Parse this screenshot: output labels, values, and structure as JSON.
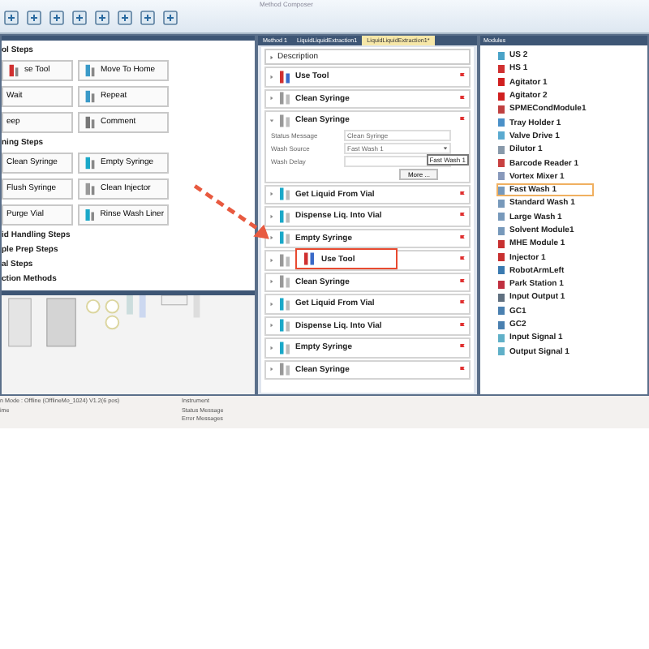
{
  "window": {
    "title": "Method Composer"
  },
  "palette": {
    "groups": [
      {
        "title": "ol Steps",
        "buttons": [
          {
            "label": "se Tool",
            "kind": "tool"
          },
          {
            "label": "Move To Home",
            "kind": "home"
          },
          {
            "label": "Wait",
            "kind": "plain"
          },
          {
            "label": "Repeat",
            "kind": "repeat"
          },
          {
            "label": "eep",
            "kind": "plain"
          },
          {
            "label": "Comment",
            "kind": "comment"
          }
        ]
      },
      {
        "title": "ning Steps",
        "buttons": [
          {
            "label": "Clean Syringe",
            "kind": "plain"
          },
          {
            "label": "Empty Syringe",
            "kind": "transfer"
          },
          {
            "label": "Flush Syringe",
            "kind": "plain"
          },
          {
            "label": "Clean Injector",
            "kind": "clean"
          },
          {
            "label": "Purge Vial",
            "kind": "plain"
          },
          {
            "label": "Rinse Wash Liner",
            "kind": "transfer"
          }
        ]
      },
      {
        "title": "id Handling Steps"
      },
      {
        "title": "ple Prep Steps"
      },
      {
        "title": "al Steps"
      },
      {
        "title": "ction Methods"
      }
    ]
  },
  "editor": {
    "tabs": [
      {
        "label": "Method 1",
        "selected": false
      },
      {
        "label": "LiquidLiquidExtraction1",
        "selected": false
      },
      {
        "label": "LiquidLiquidExtraction1*",
        "selected": true
      }
    ],
    "description": "Description",
    "steps": [
      {
        "name": "Use Tool",
        "kind": "tool",
        "expanded": false,
        "drag_target": false
      },
      {
        "name": "Clean Syringe",
        "kind": "clean",
        "expanded": false,
        "drag_target": false
      },
      {
        "name": "Clean Syringe",
        "kind": "clean",
        "expanded": true,
        "drag_target": false,
        "fields": [
          {
            "label": "Status Message",
            "value": "Clean Syringe",
            "kind": "text"
          },
          {
            "label": "Wash Source",
            "value": "Fast Wash 1",
            "kind": "select"
          },
          {
            "label": "Wash Delay",
            "kind": "number"
          }
        ],
        "tooltip": "Fast Wash 1",
        "more": "More ..."
      },
      {
        "name": "Get Liquid From Vial",
        "kind": "transfer",
        "expanded": false,
        "drag_target": false
      },
      {
        "name": "Dispense Liq. Into Vial",
        "kind": "transfer",
        "expanded": false,
        "drag_target": false
      },
      {
        "name": "Empty Syringe",
        "kind": "transfer",
        "expanded": false,
        "drag_target": false
      },
      {
        "kind": "clean",
        "expanded": false,
        "drag_target": true
      },
      {
        "name": "Clean Syringe",
        "kind": "clean",
        "expanded": false,
        "drag_target": false
      },
      {
        "name": "Get Liquid From Vial",
        "kind": "transfer",
        "expanded": false,
        "drag_target": false
      },
      {
        "name": "Dispense Liq. Into Vial",
        "kind": "transfer",
        "expanded": false,
        "drag_target": false
      },
      {
        "name": "Empty Syringe",
        "kind": "transfer",
        "expanded": false,
        "drag_target": false
      },
      {
        "name": "Clean Syringe",
        "kind": "clean",
        "expanded": false,
        "drag_target": false
      }
    ],
    "drag_preview": {
      "label": "Use Tool"
    }
  },
  "modules": {
    "title": "Modules",
    "items": [
      {
        "name": "US 2",
        "color": "#4aa3c8",
        "selected": false
      },
      {
        "name": "HS 1",
        "color": "#d03030",
        "selected": false
      },
      {
        "name": "Agitator 1",
        "color": "#d02020",
        "selected": false
      },
      {
        "name": "Agitator 2",
        "color": "#d02020",
        "selected": false
      },
      {
        "name": "SPMECondModule1",
        "color": "#c04040",
        "selected": false
      },
      {
        "name": "Tray Holder 1",
        "color": "#4a90c8",
        "selected": false
      },
      {
        "name": "Valve Drive 1",
        "color": "#5aaad0",
        "selected": false
      },
      {
        "name": "Dilutor 1",
        "color": "#8899aa",
        "selected": false
      },
      {
        "name": "Barcode Reader 1",
        "color": "#c84040",
        "selected": false
      },
      {
        "name": "Vortex Mixer 1",
        "color": "#8899bb",
        "selected": false
      },
      {
        "name": "Fast Wash 1",
        "color": "#7799bb",
        "selected": true
      },
      {
        "name": "Standard Wash 1",
        "color": "#7799bb",
        "selected": false
      },
      {
        "name": "Large Wash 1",
        "color": "#7799bb",
        "selected": false
      },
      {
        "name": "Solvent Module1",
        "color": "#7799bb",
        "selected": false
      },
      {
        "name": "MHE Module 1",
        "color": "#c83030",
        "selected": false
      },
      {
        "name": "Injector 1",
        "color": "#c83030",
        "selected": false
      },
      {
        "name": "RobotArmLeft",
        "color": "#3a7ab0",
        "selected": false
      },
      {
        "name": "Park Station 1",
        "color": "#c03040",
        "selected": false
      },
      {
        "name": "Input Output 1",
        "color": "#607080",
        "selected": false
      },
      {
        "name": "GC1",
        "color": "#4a80b0",
        "selected": false
      },
      {
        "name": "GC2",
        "color": "#4a80b0",
        "selected": false
      },
      {
        "name": "Input Signal 1",
        "color": "#60b0c8",
        "selected": false
      },
      {
        "name": "Output Signal 1",
        "color": "#60b0c8",
        "selected": false
      }
    ]
  },
  "status_bar": {
    "left": [
      "n Mode : Offline (OfflineMo_1024) V1.2(6 pos)",
      "ime"
    ],
    "right": [
      "Instrument",
      "Status Message",
      "Error Messages"
    ]
  }
}
